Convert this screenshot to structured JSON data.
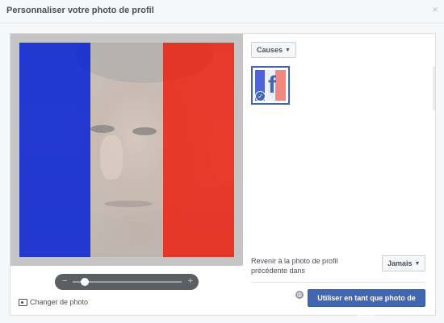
{
  "dialog": {
    "title": "Personnaliser votre photo de profil",
    "close_symbol": "×"
  },
  "preview": {
    "overlay": "french-flag",
    "colors": {
      "blue": "#1530d8",
      "white": "#ffffff",
      "red": "#f32c1c"
    },
    "zoom": {
      "minus_label": "−",
      "plus_label": "+",
      "level": 0.08
    },
    "change_photo_label": "Changer de photo"
  },
  "frames": {
    "filter_label": "Causes",
    "thumb_letter": "f",
    "check_symbol": "✓",
    "selected_index": 0
  },
  "footer": {
    "revert_label": "Revenir à la photo de profil précédente dans",
    "revert_option": "Jamais",
    "use_button_label": "Utiliser en tant que photo de profil",
    "privacy_icon": "globe-icon"
  },
  "colors": {
    "accent": "#4267b2",
    "header_bg": "#f6f7f9"
  }
}
